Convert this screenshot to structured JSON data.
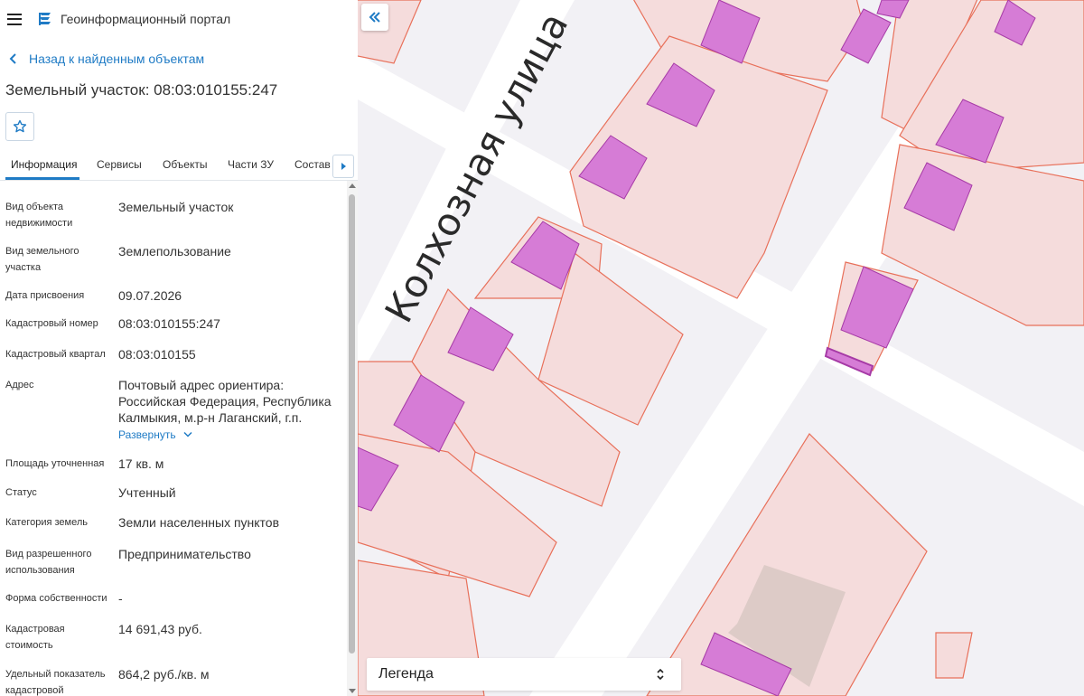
{
  "app": {
    "title": "Геоинформационный портал"
  },
  "nav": {
    "back_label": "Назад к найденным объектам"
  },
  "object": {
    "title": "Земельный участок: 08:03:010155:247"
  },
  "tabs": [
    {
      "label": "Информация",
      "active": true
    },
    {
      "label": "Сервисы",
      "active": false
    },
    {
      "label": "Объекты",
      "active": false
    },
    {
      "label": "Части ЗУ",
      "active": false
    },
    {
      "label": "Состав",
      "active": false
    }
  ],
  "properties": [
    {
      "label": "Вид объекта недвижимости",
      "value": "Земельный участок"
    },
    {
      "label": "Вид земельного участка",
      "value": "Землепользование"
    },
    {
      "label": "Дата присвоения",
      "value": "09.07.2026"
    },
    {
      "label": "Кадастровый номер",
      "value": "08:03:010155:247"
    },
    {
      "label": "Кадастровый квартал",
      "value": "08:03:010155"
    },
    {
      "label": "Адрес",
      "value": "Почтовый адрес ориентира: Российская Федерация, Республика Калмыкия, м.р-н Лаганский, г.п.",
      "expand_label": "Развернуть"
    },
    {
      "label": "Площадь уточненная",
      "value": "17 кв. м"
    },
    {
      "label": "Статус",
      "value": "Учтенный"
    },
    {
      "label": "Категория земель",
      "value": "Земли населенных пунктов"
    },
    {
      "label": "Вид разрешенного использования",
      "value": "Предпринимательство"
    },
    {
      "label": "Форма собственности",
      "value": "-"
    },
    {
      "label": "Кадастровая стоимость",
      "value": "14 691,43 руб."
    },
    {
      "label": "Удельный показатель кадастровой",
      "value": "864,2 руб./кв. м"
    }
  ],
  "map": {
    "street_label": "Колхозная улица",
    "legend_label": "Легенда",
    "colors": {
      "background": "#f2f1f5",
      "road": "#ffffff",
      "parcel_fill": "#f5dcdc",
      "parcel_stroke": "#e8705a",
      "building_fill": "#d67cd6",
      "building_stroke": "#a63aa6",
      "accent": "#1f7bc5"
    }
  }
}
